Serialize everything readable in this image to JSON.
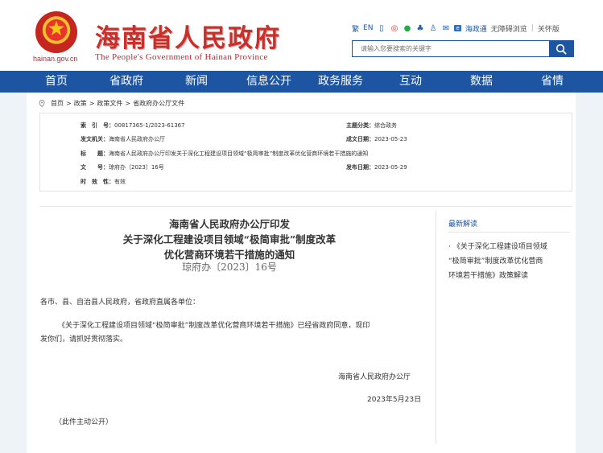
{
  "header": {
    "domain": "hainan.gov.cn",
    "title": "海南省人民政府",
    "subtitle": "The People's Government of Hainan Province",
    "toolbar": {
      "traditional": "繁",
      "english": "EN",
      "hnt": "海政通",
      "accessibility": "无障碍浏览",
      "care": "关怀版"
    },
    "search": {
      "placeholder": "请输入您要搜索的关键字"
    }
  },
  "nav": {
    "items": [
      "首页",
      "省政府",
      "新闻",
      "信息公开",
      "政务服务",
      "互动",
      "数据",
      "省情"
    ]
  },
  "breadcrumb": [
    "首页",
    "政策",
    "政策文件",
    "省政府办公厅文件"
  ],
  "meta": {
    "index_label": "索　引　号：",
    "index_value": "00817365-1/2023-61367",
    "category_label": "主题分类：",
    "category_value": "综合政务",
    "issuer_label": "发文机关：",
    "issuer_value": "海南省人民政府办公厅",
    "created_label": "成文日期：",
    "created_value": "2023-05-23",
    "title_label": "标　　题：",
    "title_value": "海南省人民政府办公厅印发关于深化工程建设项目领域“极简审批”制度改革优化营商环境若干措施的通知",
    "docno_label": "文　　号：",
    "docno_value": "琼府办〔2023〕16号",
    "published_label": "发布日期：",
    "published_value": "2023-05-29",
    "validity_label": "时　效　性：",
    "validity_value": "有效"
  },
  "document": {
    "title_line1": "海南省人民政府办公厅印发",
    "title_line2": "关于深化工程建设项目领域“极简审批”制度改革",
    "title_line3": "优化营商环境若干措施的通知",
    "doc_number": "琼府办〔2023〕16号",
    "salutation": "各市、县、自治县人民政府，省政府直属各单位：",
    "para1_line1": "《关于深化工程建设项目领域“极简审批”制度改革优化营商环境若干措施》已经省政府同意，现印",
    "para1_line2": "发你们，请抓好贯彻落实。",
    "signature": "海南省人民政府办公厅",
    "date": "2023年5月23日",
    "note": "（此件主动公开）"
  },
  "sidebar": {
    "heading": "最新解读",
    "item_line1": "· 《关于深化工程建设项目领域",
    "item_line2": "“极简审批”制度改革优化营商",
    "item_line3": "环境若干措施》政策解读"
  },
  "colors": {
    "brand_red": "#c7302b",
    "nav_blue": "#1e55a3"
  }
}
